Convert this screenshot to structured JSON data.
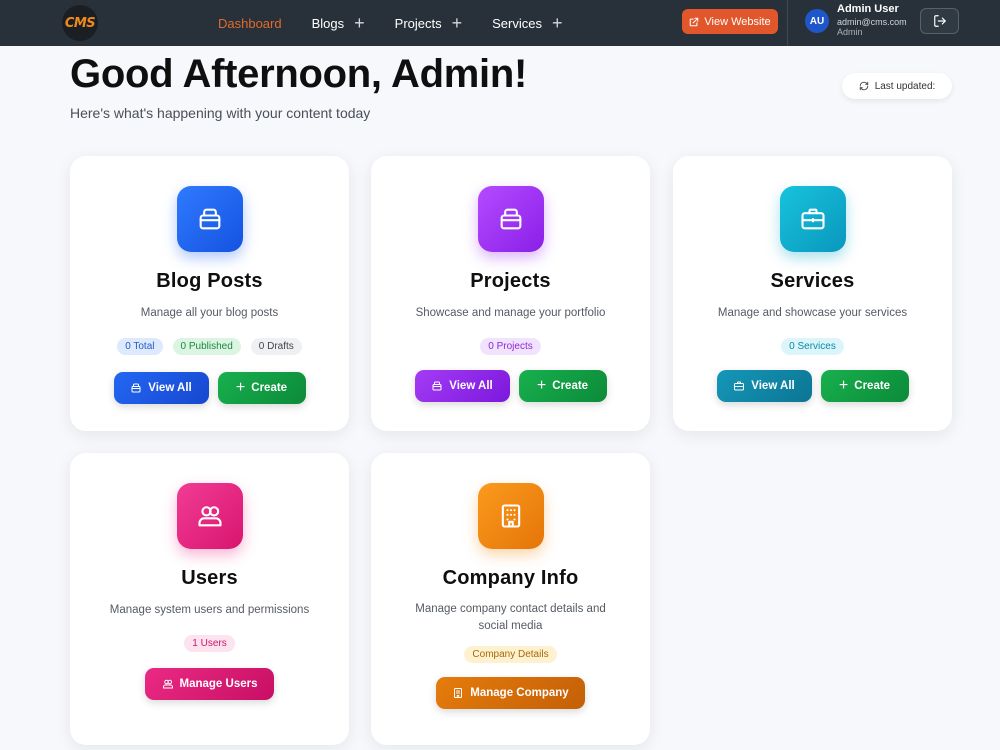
{
  "nav": {
    "logo": "CMS",
    "links": [
      {
        "label": "Dashboard"
      },
      {
        "label": "Blogs"
      },
      {
        "label": "Projects"
      },
      {
        "label": "Services"
      }
    ],
    "view_website": "View Website",
    "user": {
      "initials": "AU",
      "name": "Admin User",
      "email": "admin@cms.com",
      "role": "Admin"
    }
  },
  "header": {
    "greeting": "Good Afternoon, Admin!",
    "subtitle": "Here's what's happening with your content today",
    "last_updated": "Last updated:"
  },
  "cards": {
    "blog": {
      "title": "Blog Posts",
      "desc": "Manage all your blog posts",
      "badges": [
        "0 Total",
        "0 Published",
        "0 Drafts"
      ],
      "view_label": "View All",
      "create_label": "Create"
    },
    "projects": {
      "title": "Projects",
      "desc": "Showcase and manage your portfolio",
      "badges": [
        "0 Projects"
      ],
      "view_label": "View All",
      "create_label": "Create"
    },
    "services": {
      "title": "Services",
      "desc": "Manage and showcase your services",
      "badges": [
        "0 Services"
      ],
      "view_label": "View All",
      "create_label": "Create"
    },
    "users": {
      "title": "Users",
      "desc": "Manage system users and permissions",
      "badges": [
        "1 Users"
      ],
      "manage_label": "Manage Users"
    },
    "company": {
      "title": "Company Info",
      "desc_line1": "Manage company contact details and",
      "desc_line2": "social media",
      "badges": [
        "Company Details"
      ],
      "manage_label": "Manage Company"
    }
  },
  "colors": {
    "navbar": "#283139",
    "accent": "#e1562a",
    "blue": "#1e63f0",
    "purple": "#9a2cf0",
    "cyan": "#0aa9cc",
    "pink": "#ee2a86",
    "orange": "#f28a0f",
    "green": "#10a046"
  }
}
